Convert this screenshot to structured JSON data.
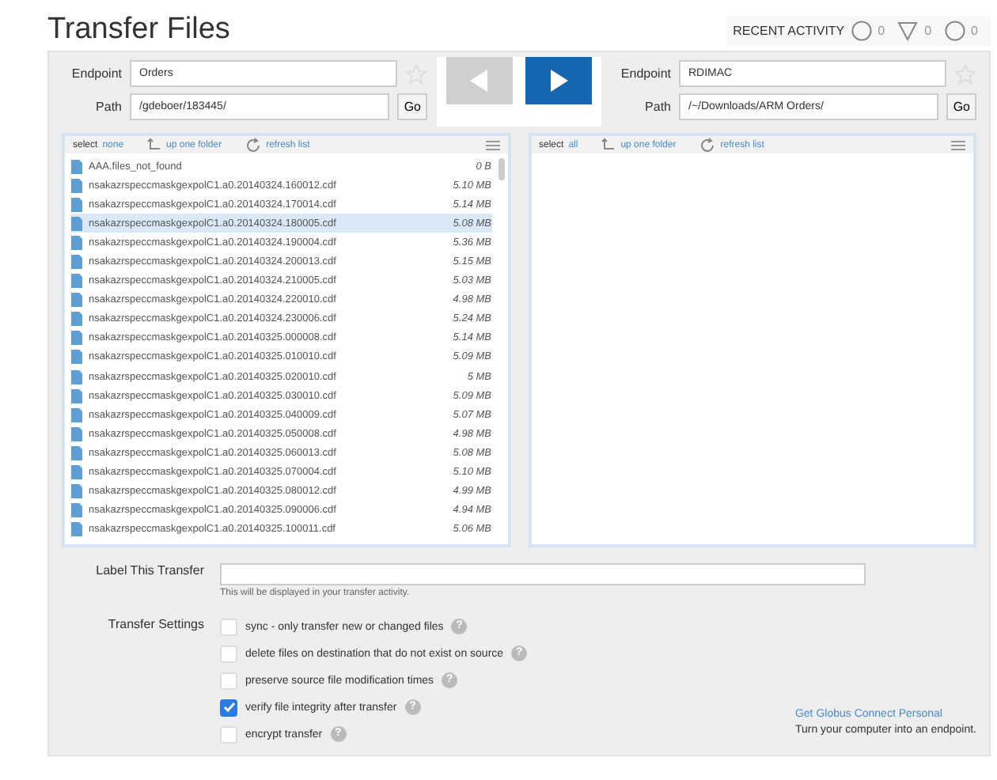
{
  "title": "Transfer Files",
  "recent_activity": {
    "label": "RECENT ACTIVITY",
    "counts": [
      {
        "kind": "circle",
        "value": "0"
      },
      {
        "kind": "triangle",
        "value": "0"
      },
      {
        "kind": "circle",
        "value": "0"
      }
    ]
  },
  "source": {
    "endpoint_label": "Endpoint",
    "endpoint": "Orders",
    "path_label": "Path",
    "path": "/gdeboer/183445/",
    "go": "Go",
    "select_label": "select",
    "select_link": "none",
    "up": "up one folder",
    "refresh": "refresh list",
    "files": [
      {
        "name": "AAA.files_not_found",
        "size": "0 B",
        "selected": false
      },
      {
        "name": "nsakazrspeccmaskgexpolC1.a0.20140324.160012.cdf",
        "size": "5.10 MB",
        "selected": false
      },
      {
        "name": "nsakazrspeccmaskgexpolC1.a0.20140324.170014.cdf",
        "size": "5.14 MB",
        "selected": false
      },
      {
        "name": "nsakazrspeccmaskgexpolC1.a0.20140324.180005.cdf",
        "size": "5.08 MB",
        "selected": true
      },
      {
        "name": "nsakazrspeccmaskgexpolC1.a0.20140324.190004.cdf",
        "size": "5.36 MB",
        "selected": false
      },
      {
        "name": "nsakazrspeccmaskgexpolC1.a0.20140324.200013.cdf",
        "size": "5.15 MB",
        "selected": false
      },
      {
        "name": "nsakazrspeccmaskgexpolC1.a0.20140324.210005.cdf",
        "size": "5.03 MB",
        "selected": false
      },
      {
        "name": "nsakazrspeccmaskgexpolC1.a0.20140324.220010.cdf",
        "size": "4.98 MB",
        "selected": false
      },
      {
        "name": "nsakazrspeccmaskgexpolC1.a0.20140324.230006.cdf",
        "size": "5.24 MB",
        "selected": false
      },
      {
        "name": "nsakazrspeccmaskgexpolC1.a0.20140325.000008.cdf",
        "size": "5.14 MB",
        "selected": false
      },
      {
        "name": "nsakazrspeccmaskgexpolC1.a0.20140325.010010.cdf",
        "size": "5.09 MB",
        "selected": false
      },
      {
        "name": "nsakazrspeccmaskgexpolC1.a0.20140325.020010.cdf",
        "size": "5 MB",
        "selected": false
      },
      {
        "name": "nsakazrspeccmaskgexpolC1.a0.20140325.030010.cdf",
        "size": "5.09 MB",
        "selected": false
      },
      {
        "name": "nsakazrspeccmaskgexpolC1.a0.20140325.040009.cdf",
        "size": "5.07 MB",
        "selected": false
      },
      {
        "name": "nsakazrspeccmaskgexpolC1.a0.20140325.050008.cdf",
        "size": "4.98 MB",
        "selected": false
      },
      {
        "name": "nsakazrspeccmaskgexpolC1.a0.20140325.060013.cdf",
        "size": "5.08 MB",
        "selected": false
      },
      {
        "name": "nsakazrspeccmaskgexpolC1.a0.20140325.070004.cdf",
        "size": "5.10 MB",
        "selected": false
      },
      {
        "name": "nsakazrspeccmaskgexpolC1.a0.20140325.080012.cdf",
        "size": "4.99 MB",
        "selected": false
      },
      {
        "name": "nsakazrspeccmaskgexpolC1.a0.20140325.090006.cdf",
        "size": "4.94 MB",
        "selected": false
      },
      {
        "name": "nsakazrspeccmaskgexpolC1.a0.20140325.100011.cdf",
        "size": "5.06 MB",
        "selected": false
      }
    ]
  },
  "destination": {
    "endpoint_label": "Endpoint",
    "endpoint": "RDIMAC",
    "path_label": "Path",
    "path": "/~/Downloads/ARM Orders/",
    "go": "Go",
    "select_label": "select",
    "select_link": "all",
    "up": "up one folder",
    "refresh": "refresh list"
  },
  "arrows": [
    {
      "kind": "left",
      "disabled": true
    },
    {
      "kind": "right",
      "disabled": false
    }
  ],
  "label_field": {
    "label": "Label This Transfer",
    "hint": "This will be displayed in your transfer activity."
  },
  "settings": {
    "label": "Transfer Settings",
    "help_glyph": "?",
    "options": [
      {
        "text": "sync - only transfer new or changed files",
        "checked": false
      },
      {
        "text": "delete files on destination that do not exist on source",
        "checked": false
      },
      {
        "text": "preserve source file modification times",
        "checked": false
      },
      {
        "text": "verify file integrity after transfer",
        "checked": true
      },
      {
        "text": "encrypt transfer",
        "checked": false
      }
    ]
  },
  "promo": {
    "link": "Get Globus Connect Personal",
    "text": "Turn your computer into an endpoint."
  }
}
